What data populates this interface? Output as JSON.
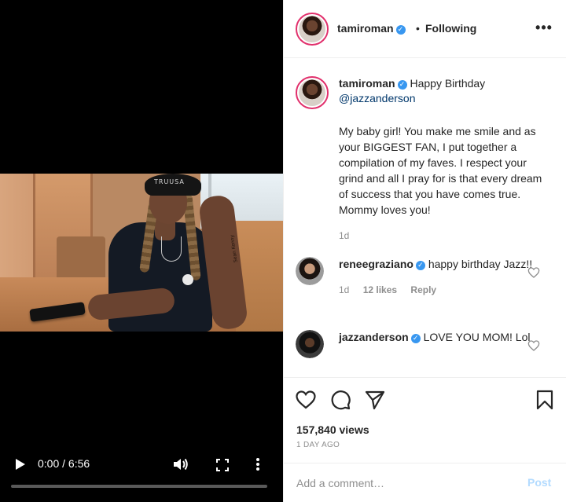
{
  "video": {
    "current_time": "0:00",
    "separator": "/",
    "duration": "6:56",
    "progress_fraction": 0.0,
    "beanie_text": "TRUUSA",
    "tattoo_text": "Sean Kenny"
  },
  "post": {
    "author": "tamiroman",
    "separator": "•",
    "follow_status": "Following",
    "more_label": "•••"
  },
  "caption": {
    "author": "tamiroman",
    "text_lead": "Happy Birthday",
    "mention": "@jazzanderson",
    "body": "My baby girl! You make me smile and as your BIGGEST FAN, I put together a compilation of my faves. I respect your grind and all I pray for is that every dream of success that you have comes true. Mommy loves you!",
    "age": "1d"
  },
  "comments": [
    {
      "user": "reneegraziano",
      "text": "happy birthday Jazz!!",
      "age": "1d",
      "likes": "12 likes",
      "reply": "Reply"
    },
    {
      "user": "jazzanderson",
      "text": "LOVE YOU MOM! Lol",
      "age": "",
      "likes": "",
      "reply": ""
    }
  ],
  "actions": {
    "views": "157,840 views",
    "date": "1 DAY AGO"
  },
  "comment_box": {
    "placeholder": "Add a comment…",
    "post_label": "Post"
  },
  "colors": {
    "accent": "#3897f0",
    "post_disabled": "#b3dbff",
    "muted": "#8e8e8e",
    "story_ring": "#e1306c"
  }
}
